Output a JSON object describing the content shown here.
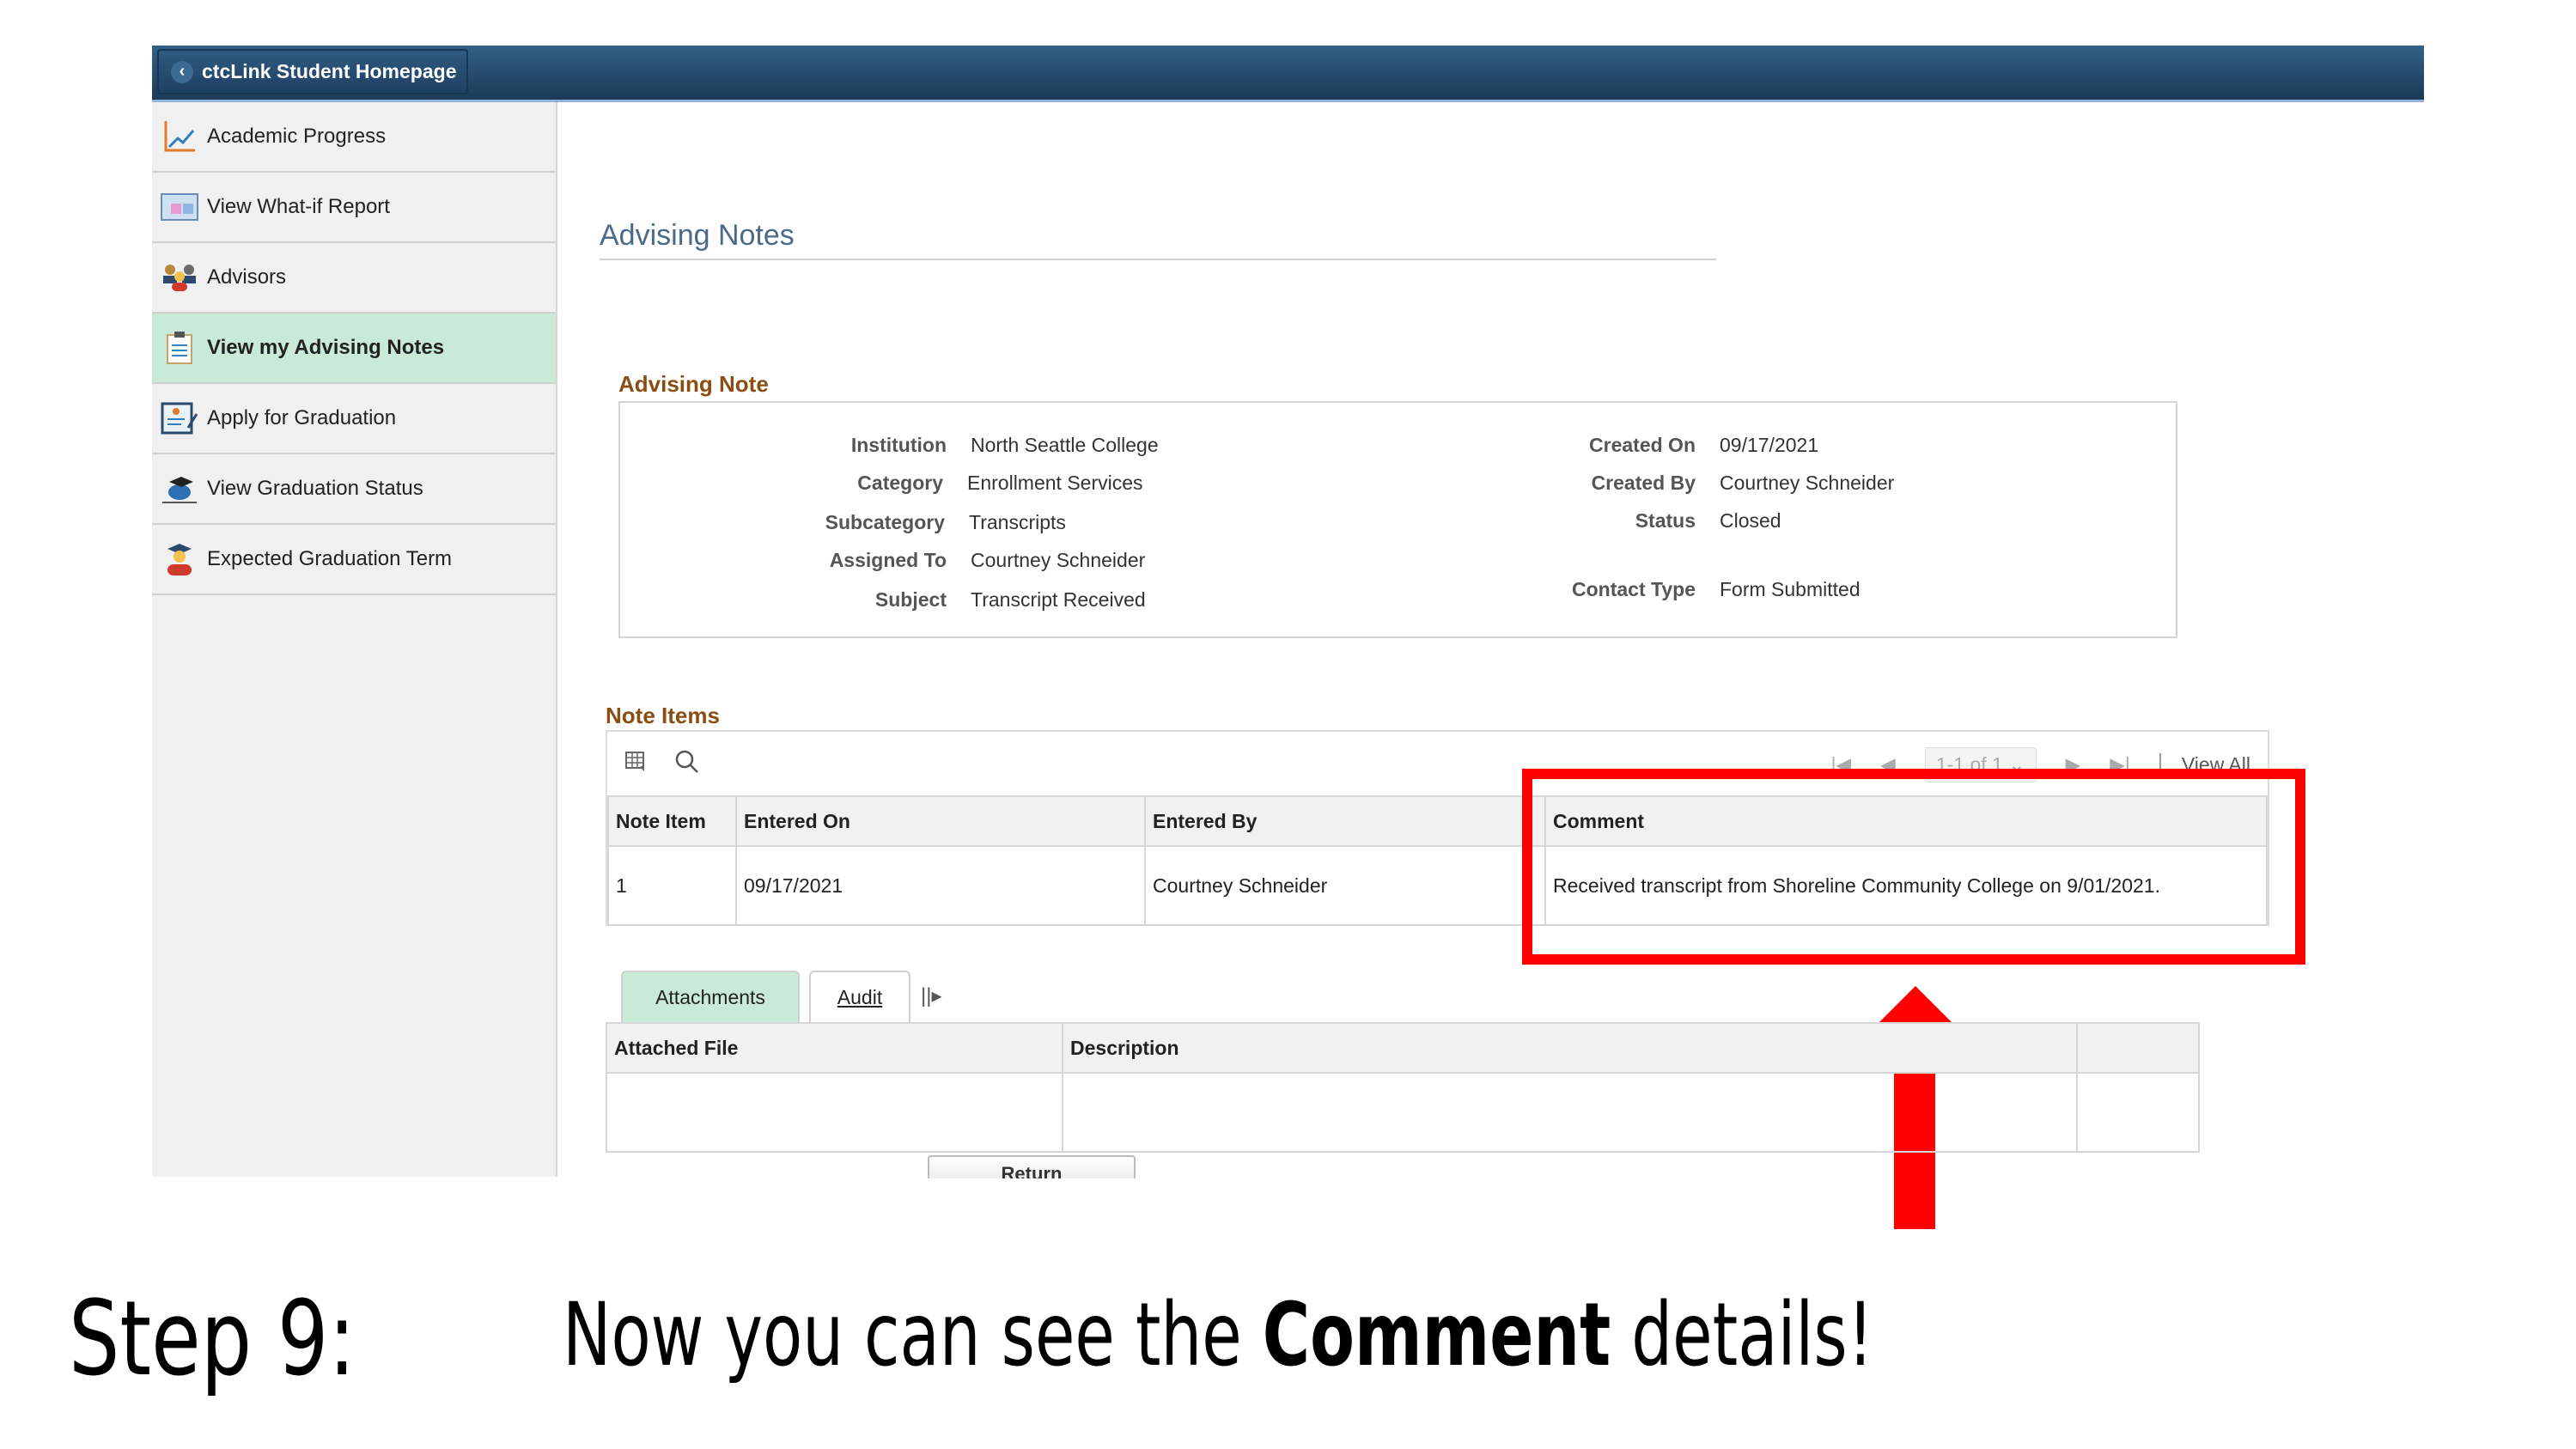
{
  "header": {
    "home_label": "ctcLink Student Homepage"
  },
  "sidebar": {
    "items": [
      {
        "label": "Academic Progress",
        "icon": "chart-icon"
      },
      {
        "label": "View What-if Report",
        "icon": "report-icon"
      },
      {
        "label": "Advisors",
        "icon": "people-icon"
      },
      {
        "label": "View my Advising Notes",
        "icon": "clipboard-icon",
        "active": true
      },
      {
        "label": "Apply for Graduation",
        "icon": "form-edit-icon"
      },
      {
        "label": "View Graduation Status",
        "icon": "graduation-cap-icon"
      },
      {
        "label": "Expected Graduation Term",
        "icon": "graduate-icon"
      }
    ]
  },
  "page": {
    "title": "Advising Notes"
  },
  "advising_note": {
    "section_title": "Advising Note",
    "left": [
      {
        "label": "Institution",
        "value": "North Seattle College"
      },
      {
        "label": "Category",
        "value": "Enrollment Services"
      },
      {
        "label": "Subcategory",
        "value": "Transcripts"
      },
      {
        "label": "Assigned To",
        "value": "Courtney Schneider"
      },
      {
        "label": "Subject",
        "value": "Transcript Received"
      }
    ],
    "right": [
      {
        "label": "Created On",
        "value": "09/17/2021"
      },
      {
        "label": "Created By",
        "value": "Courtney Schneider"
      },
      {
        "label": "Status",
        "value": "Closed"
      },
      {
        "label": "Contact Type",
        "value": "Form Submitted"
      }
    ]
  },
  "note_items": {
    "section_title": "Note Items",
    "pager": {
      "range": "1-1 of 1",
      "view_all": "View All"
    },
    "columns": [
      "Note Item",
      "Entered On",
      "Entered By",
      "Comment"
    ],
    "rows": [
      [
        "1",
        "09/17/2021",
        "Courtney Schneider",
        "Received transcript from Shoreline Community College on 9/01/2021."
      ]
    ]
  },
  "tabs": [
    {
      "label": "Attachments",
      "active": true
    },
    {
      "label": "Audit"
    }
  ],
  "attachments": {
    "columns": [
      "Attached File",
      "Description",
      ""
    ]
  },
  "return_label": "Return",
  "caption": {
    "step": "Step 9:",
    "pre": "Now you can see the ",
    "bold": "Comment",
    "post": " details!"
  },
  "colors": {
    "highlight": "#ff0000",
    "active_nav": "#c9ead6",
    "section_title": "#8a4e12"
  }
}
